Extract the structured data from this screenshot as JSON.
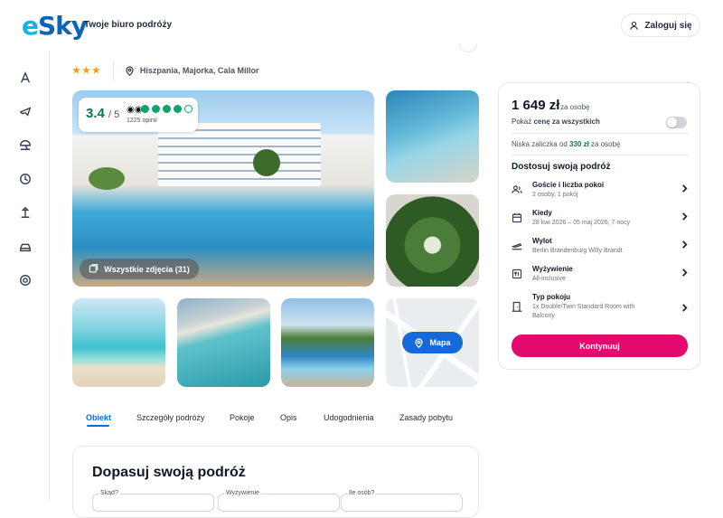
{
  "header": {
    "logo_e": "e",
    "logo_rest": "Sky",
    "tagline": "Twoje biuro podróży",
    "login_label": "Zaloguj się"
  },
  "sidebar": {
    "items": [
      "hotel-icon",
      "flight-icon",
      "sun-umbrella-icon",
      "clock-icon",
      "beach-icon",
      "car-icon",
      "support-icon"
    ]
  },
  "breadcrumb": {
    "stars": "★★★",
    "location": "Hiszpania, Majorka, Cala Millor"
  },
  "rating": {
    "score": "3.4",
    "of": "/ 5",
    "reviews": "1225 opinii"
  },
  "gallery": {
    "all_photos_label": "Wszystkie zdjęcia (31)",
    "map_label": "Mapa"
  },
  "tabs": [
    "Obiekt",
    "Szczegóły podróży",
    "Pokoje",
    "Opis",
    "Udogodnienia",
    "Zasady pobytu"
  ],
  "customize_section": {
    "title": "Dopasuj swoją podróż",
    "fields": [
      "Skąd?",
      "Wyżywienie",
      "Ile osób?"
    ]
  },
  "price_card": {
    "price": "1 649 zł",
    "per_person": "za osobę",
    "show_total_prefix": "Pokaż ",
    "show_total_bold": "cenę za wszystkich",
    "deposit_prefix": "Niska zaliczka od ",
    "deposit_amount": "330 zł",
    "deposit_suffix": " za osobę",
    "customize_heading": "Dostosuj swoją podróż",
    "options": [
      {
        "title": "Goście i liczba pokoi",
        "sub": "2 osoby, 1 pokój"
      },
      {
        "title": "Kiedy",
        "sub": "28 kwi 2026 – 05 maj 2026, 7 nocy"
      },
      {
        "title": "Wylot",
        "sub": "Berlin Brandenburg Willy Brandt"
      },
      {
        "title": "Wyżywienie",
        "sub": "All-inclusive"
      },
      {
        "title": "Typ pokoju",
        "sub": "1x Double/Twin Standard Room with Balcony"
      }
    ],
    "continue_label": "Kontynuuj"
  },
  "colors": {
    "brand_blue": "#1669d8",
    "cta_pink": "#e20a6f",
    "rating_green": "#047857"
  }
}
